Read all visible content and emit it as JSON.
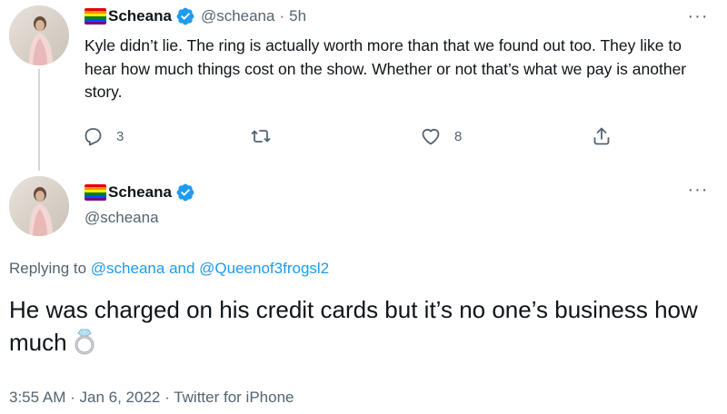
{
  "colors": {
    "text": "#0f1419",
    "muted": "#536471",
    "link": "#1d9bf0",
    "verified": "#1d9bf0",
    "divider": "#cfd9de"
  },
  "tweet_parent": {
    "author_name": "Scheana",
    "author_handle": "@scheana",
    "separator": "·",
    "time_ago": "5h",
    "more_icon": "more-horizontal-icon",
    "more_label": "···",
    "body": "Kyle didn’t lie. The ring is actually worth more than that we found out too. They like to hear how much things cost on the show. Whether or not that’s what we pay is another story.",
    "actions": {
      "reply_count": "3",
      "retweet_count": "",
      "like_count": "8"
    }
  },
  "tweet_main": {
    "author_name": "Scheana",
    "author_handle": "@scheana",
    "more_label": "···",
    "replying_prefix": "Replying to",
    "replying_user1": "@scheana",
    "replying_and": "and",
    "replying_user2": "@Queenof3frogsl2",
    "body": "He was charged on his credit cards but it’s no one’s business how much",
    "emoji_icon": "ring-icon",
    "timestamp": "3:55 AM",
    "date": "Jan 6, 2022",
    "source": "Twitter for iPhone",
    "meta_separator": "·"
  }
}
